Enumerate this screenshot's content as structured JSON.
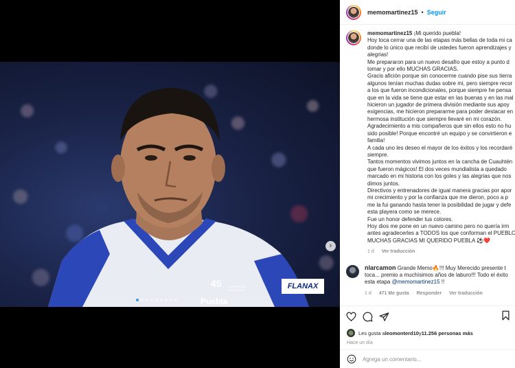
{
  "post": {
    "username": "memomartinez15",
    "separator": "•",
    "follow_label": "Seguir"
  },
  "media": {
    "badge_number": "45",
    "badge_caption": "CAMPEÓN DE LIGA 1982-83",
    "sponsor": "FLANAX",
    "club_word": "Puebla",
    "carousel_total": 9,
    "carousel_active": 1,
    "next_icon": "chevron-right-icon"
  },
  "caption": {
    "username": "memomartinez15",
    "lines": [
      "¡Mi querido puebla!",
      "Hoy toca cerrar una de las etapas más bellas de toda mi ca",
      "donde lo único que recibí de ustedes fueron aprendizajes y",
      "alegrias!",
      "Me prepararon para un nuevo desafío que estoy a punto d",
      "tomar y por ello MUCHAS GRACIAS.",
      "Gracis afición porque sin conocerme cuando pise sus tierra",
      "algunos tenían muchas dudas sobre mi, pero siempre recor",
      "a los que fueron incondicionales, porque siempre he pensa",
      "que en la vida se tiene que estar en las buenas y en las mal",
      "hicieron un jugador de primera división mediante sus apoy",
      "exigencias, me hicieron prepararme para poder destacar en",
      "hermosa institución que siempre llevaré en mi corazón.",
      "Agradecimiento a mis compañeros que sin ellos esto no hu",
      "sido posible! Porque encontré un equipo y se convirtieron e",
      "familia!",
      "A cada uno les deseo el mayor de los éxitos y los recordaré",
      "siempre.",
      "Tantos momentos vivimos juntos en la cancha de Cuauhtén",
      "que fueron mágicos! El dos veces mundialista a quedado",
      "marcado en mi historia con los goles y las alegrias que nos",
      "dimos juntos.",
      "Directivos y entrenadores de igual manera gracias por apor",
      "mi crecimiento y por la confianza que me dieron, poco a p",
      "me la fui ganando hasta tener la posibilidad de jugar y defe",
      "esta playera como se merece.",
      "Fue un honor defender tus colores.",
      "Hoy dios me pone en un nuevo camino pero no quería irm",
      "antes agradecerles a TODOS los que conforman el PUEBLO",
      "MUCHAS GRACIAS MI QUERIDO PUEBLA ⚽❤️"
    ],
    "age": "1 d",
    "translate": "Ver traducción"
  },
  "comment": {
    "username": "nlarcamon",
    "line1": "Grande Memo🔥!!! Muy Merecido presente t",
    "line2": "toca... premio a muchísimos años de laburo!!! Todo el éxito",
    "line3_prefix": "esta etapa ",
    "mention": "@memomartinez15",
    "line3_suffix": " !!",
    "age": "1 d",
    "likes": "471 Me gusta",
    "reply": "Responder",
    "translate": "Ver traducción"
  },
  "actions": {
    "icons": [
      "heart-icon",
      "comment-icon",
      "share-icon",
      "bookmark-icon"
    ],
    "likes_prefix": "Les gusta a ",
    "likes_user": "leomonterd10",
    "likes_mid": " y ",
    "likes_count": "11.256 personas más",
    "posted": "Hace un día",
    "comment_placeholder": "Agrega un comentario..."
  }
}
